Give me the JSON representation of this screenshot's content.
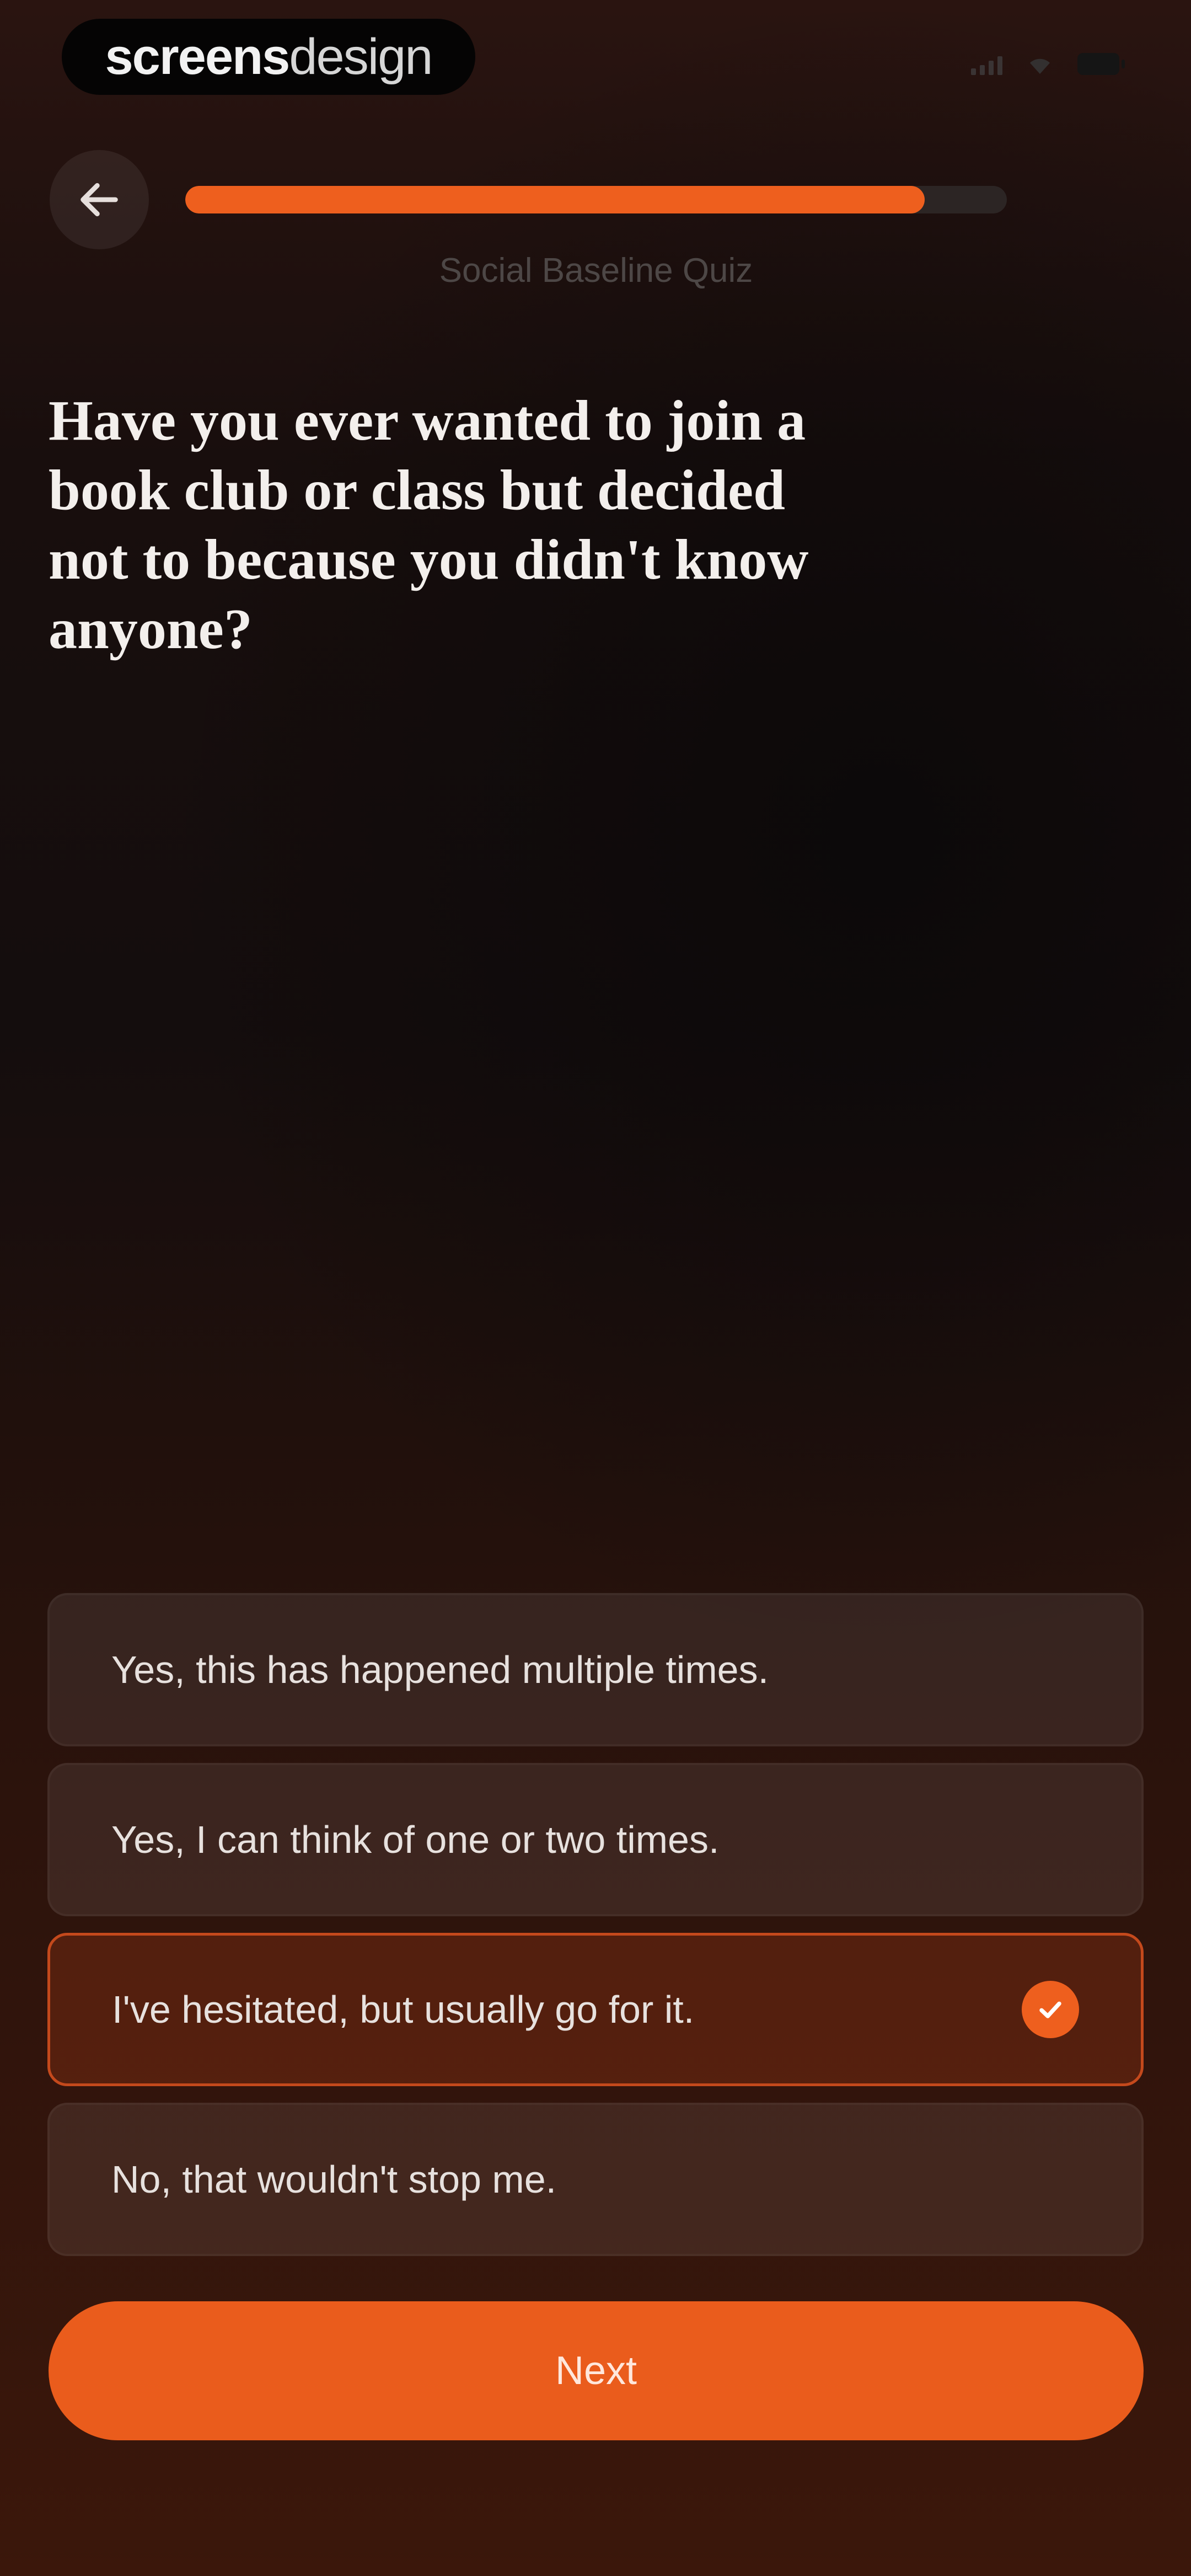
{
  "status_bar": {
    "brand_bold": "screens",
    "brand_light": "design"
  },
  "header": {
    "progress": 0.9,
    "quiz_label": "Social Baseline Quiz"
  },
  "question": "Have you ever wanted to join a book club or class but decided not to because you didn't know anyone?",
  "options": [
    {
      "label": "Yes, this has happened multiple times.",
      "selected": false
    },
    {
      "label": "Yes, I can think of one or two times.",
      "selected": false
    },
    {
      "label": "I've hesitated, but usually go for it.",
      "selected": true
    },
    {
      "label": "No, that wouldn't stop me.",
      "selected": false
    }
  ],
  "next_button": {
    "label": "Next"
  },
  "colors": {
    "accent": "#EE5F1E",
    "background": "#140D0D"
  },
  "icons": {
    "back": "arrow-left-icon",
    "selected": "checkmark-circle-icon"
  }
}
